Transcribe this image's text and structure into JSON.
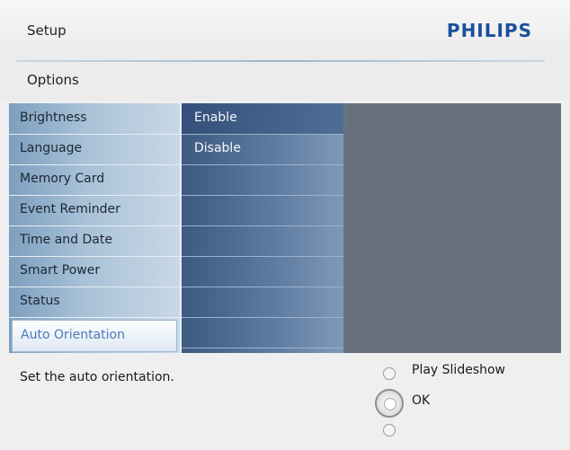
{
  "header": {
    "title": "Setup",
    "brand": "PHILIPS"
  },
  "section": {
    "label": "Options"
  },
  "menu": {
    "items": [
      {
        "label": "Brightness",
        "selected": false
      },
      {
        "label": "Language",
        "selected": false
      },
      {
        "label": "Memory Card",
        "selected": false
      },
      {
        "label": "Event Reminder",
        "selected": false
      },
      {
        "label": "Time and Date",
        "selected": false
      },
      {
        "label": "Smart Power",
        "selected": false
      },
      {
        "label": "Status",
        "selected": false
      },
      {
        "label": "Auto Orientation",
        "selected": true
      }
    ]
  },
  "submenu": {
    "items": [
      {
        "label": "Enable",
        "highlighted": true
      },
      {
        "label": "Disable",
        "highlighted": false
      },
      {
        "label": ""
      },
      {
        "label": ""
      },
      {
        "label": ""
      },
      {
        "label": ""
      },
      {
        "label": ""
      },
      {
        "label": ""
      }
    ]
  },
  "footer": {
    "hint": "Set the auto orientation.",
    "controls": {
      "top_label": "Play Slideshow",
      "center_label": "OK"
    }
  },
  "colors": {
    "brand": "#1b4f9c",
    "selected_text": "#4b79b6",
    "panel_bg": "#67707f"
  }
}
